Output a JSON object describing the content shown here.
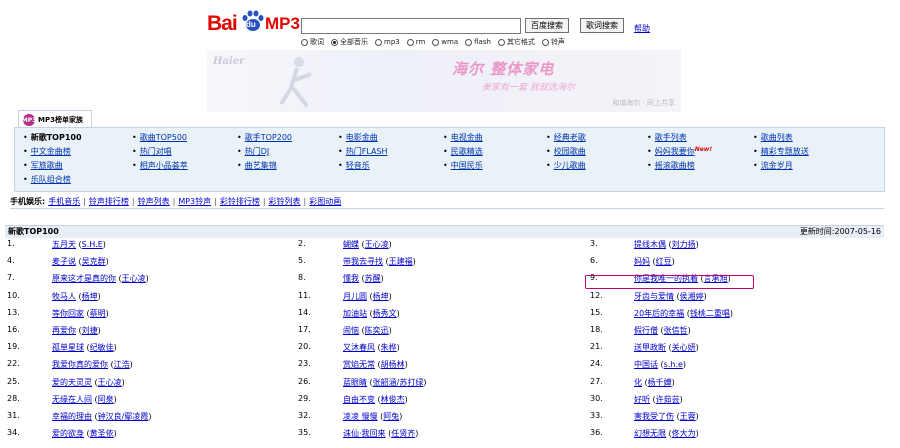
{
  "header": {
    "logo": {
      "bai": "Bai",
      "du": "du",
      "mp3": "MP3"
    },
    "search_placeholder": "",
    "search_btn": "百度搜索",
    "lyrics_btn": "歌词搜索",
    "help": "帮助",
    "radios": [
      {
        "label": "歌词",
        "checked": false
      },
      {
        "label": "全部音乐",
        "checked": true
      },
      {
        "label": "mp3",
        "checked": false
      },
      {
        "label": "rm",
        "checked": false
      },
      {
        "label": "wma",
        "checked": false
      },
      {
        "label": "flash",
        "checked": false
      },
      {
        "label": "其它格式",
        "checked": false
      },
      {
        "label": "铃声",
        "checked": false
      }
    ]
  },
  "banner": {
    "brand": "Haier",
    "title": "海尔 整体家电",
    "sub": "美家有一套  我就选海尔",
    "small": "和谐海尔 · 同上共享"
  },
  "categories": {
    "tab_title": "MP3榜单家族",
    "badge": "MP3",
    "items": [
      [
        "新歌TOP100",
        "歌曲TOP500",
        "歌手TOP200",
        "电影金曲",
        "电视金曲",
        "经典老歌",
        "歌手列表",
        "歌曲列表"
      ],
      [
        "中文金曲榜",
        "热门对唱",
        "热门DJ",
        "热门FLASH",
        "民歌精选",
        "校园歌曲",
        "妈妈我要你",
        "精彩专题放送"
      ],
      [
        "军旅歌曲",
        "相声小品荟萃",
        "曲艺集锦",
        "轻音乐",
        "中国民乐",
        "少儿歌曲",
        "摇滚歌曲榜",
        "流金岁月"
      ],
      [
        "乐队组合榜"
      ]
    ],
    "new_tag": "New!"
  },
  "mobile": {
    "label": "手机娱乐:",
    "links": [
      "手机音乐",
      "铃声排行榜",
      "铃声列表",
      "MP3铃声",
      "彩铃排行榜",
      "彩铃列表",
      "彩图动画"
    ]
  },
  "list": {
    "title": "新歌TOP100",
    "update": "更新时间:2007-05-16",
    "rows": [
      [
        {
          "n": "1.",
          "s": "五月天",
          "a": "S.H.E"
        },
        {
          "n": "2.",
          "s": "蝴蝶",
          "a": "王心凌"
        },
        {
          "n": "3.",
          "s": "提线木偶",
          "a": "刘力扬"
        }
      ],
      [
        {
          "n": "4.",
          "s": "麦子说",
          "a": "吴克群"
        },
        {
          "n": "5.",
          "s": "带我去寻找",
          "a": "王建福"
        },
        {
          "n": "6.",
          "s": "妈妈",
          "a": "红豆"
        }
      ],
      [
        {
          "n": "7.",
          "s": "原来这才是真的你",
          "a": "王心凌"
        },
        {
          "n": "8.",
          "s": "懂我",
          "a": "苏醒"
        },
        {
          "n": "9.",
          "s": "你是我唯一的执着",
          "a": "言承旭"
        }
      ],
      [
        {
          "n": "10.",
          "s": "牧马人",
          "a": "杨坤"
        },
        {
          "n": "11.",
          "s": "月儿圆",
          "a": "杨坤"
        },
        {
          "n": "12.",
          "s": "牙齿与爱情",
          "a": "侯湘婷"
        }
      ],
      [
        {
          "n": "13.",
          "s": "等你回家",
          "a": "蔡明"
        },
        {
          "n": "14.",
          "s": "加油站",
          "a": "杨秀文"
        },
        {
          "n": "15.",
          "s": "20年后的幸福",
          "a": "钱桃二重唱"
        }
      ],
      [
        {
          "n": "16.",
          "s": "再爱你",
          "a": "刘捷"
        },
        {
          "n": "17.",
          "s": "闹恼",
          "a": "陈奕迅"
        },
        {
          "n": "18.",
          "s": "假行僧",
          "a": "张信哲"
        }
      ],
      [
        {
          "n": "19.",
          "s": "孤单星球",
          "a": "纪敏佳"
        },
        {
          "n": "20.",
          "s": "又沐春风",
          "a": "朱桦"
        },
        {
          "n": "21.",
          "s": "送甲政断",
          "a": "关心妍"
        }
      ],
      [
        {
          "n": "22.",
          "s": "我爱你真的爱你",
          "a": "江浩"
        },
        {
          "n": "23.",
          "s": "赏焰无常",
          "a": "胡杨林"
        },
        {
          "n": "24.",
          "s": "中国话",
          "a": "s.h.e"
        }
      ],
      [
        {
          "n": "25.",
          "s": "爱的天灵灵",
          "a": "王心凌"
        },
        {
          "n": "26.",
          "s": "蓝眼睛",
          "a": "张韶涵/苏打绿"
        },
        {
          "n": "27.",
          "s": "化",
          "a": "杨千嬅"
        }
      ],
      [
        {
          "n": "28.",
          "s": "无缘在人间",
          "a": "阿泉"
        },
        {
          "n": "29.",
          "s": "自由不变",
          "a": "林俊杰"
        },
        {
          "n": "30.",
          "s": "好听",
          "a": "许茹芸"
        }
      ],
      [
        {
          "n": "31.",
          "s": "幸福的理由",
          "a": "钟汉良/鄢凌霞"
        },
        {
          "n": "32.",
          "s": "凌凌 慢慢",
          "a": "阿兔"
        },
        {
          "n": "33.",
          "s": "害我受了伤",
          "a": "王蓉"
        }
      ],
      [
        {
          "n": "34.",
          "s": "爱的欲身",
          "a": "黄圣依"
        },
        {
          "n": "35.",
          "s": "诛仙·我回来",
          "a": "任贤齐"
        },
        {
          "n": "36.",
          "s": "幻想无限",
          "a": "佟大为"
        }
      ]
    ]
  }
}
